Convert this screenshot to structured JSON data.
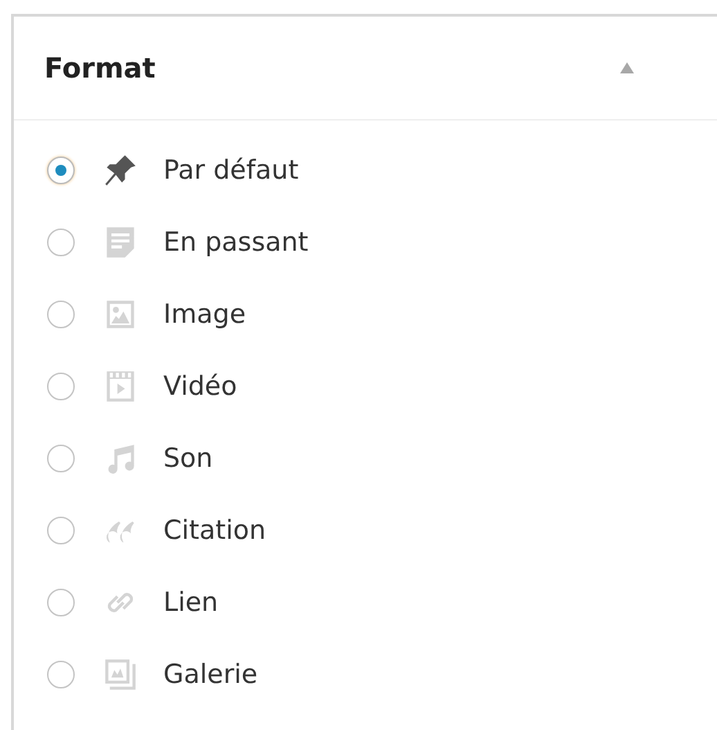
{
  "panel": {
    "title": "Format",
    "expanded": true
  },
  "formats": [
    {
      "label": "Par défaut",
      "kind": "pin",
      "selected": true
    },
    {
      "label": "En passant",
      "kind": "aside",
      "selected": false
    },
    {
      "label": "Image",
      "kind": "image",
      "selected": false
    },
    {
      "label": "Vidéo",
      "kind": "video",
      "selected": false
    },
    {
      "label": "Son",
      "kind": "audio",
      "selected": false
    },
    {
      "label": "Citation",
      "kind": "quote",
      "selected": false
    },
    {
      "label": "Lien",
      "kind": "link",
      "selected": false
    },
    {
      "label": "Galerie",
      "kind": "gallery",
      "selected": false
    }
  ]
}
